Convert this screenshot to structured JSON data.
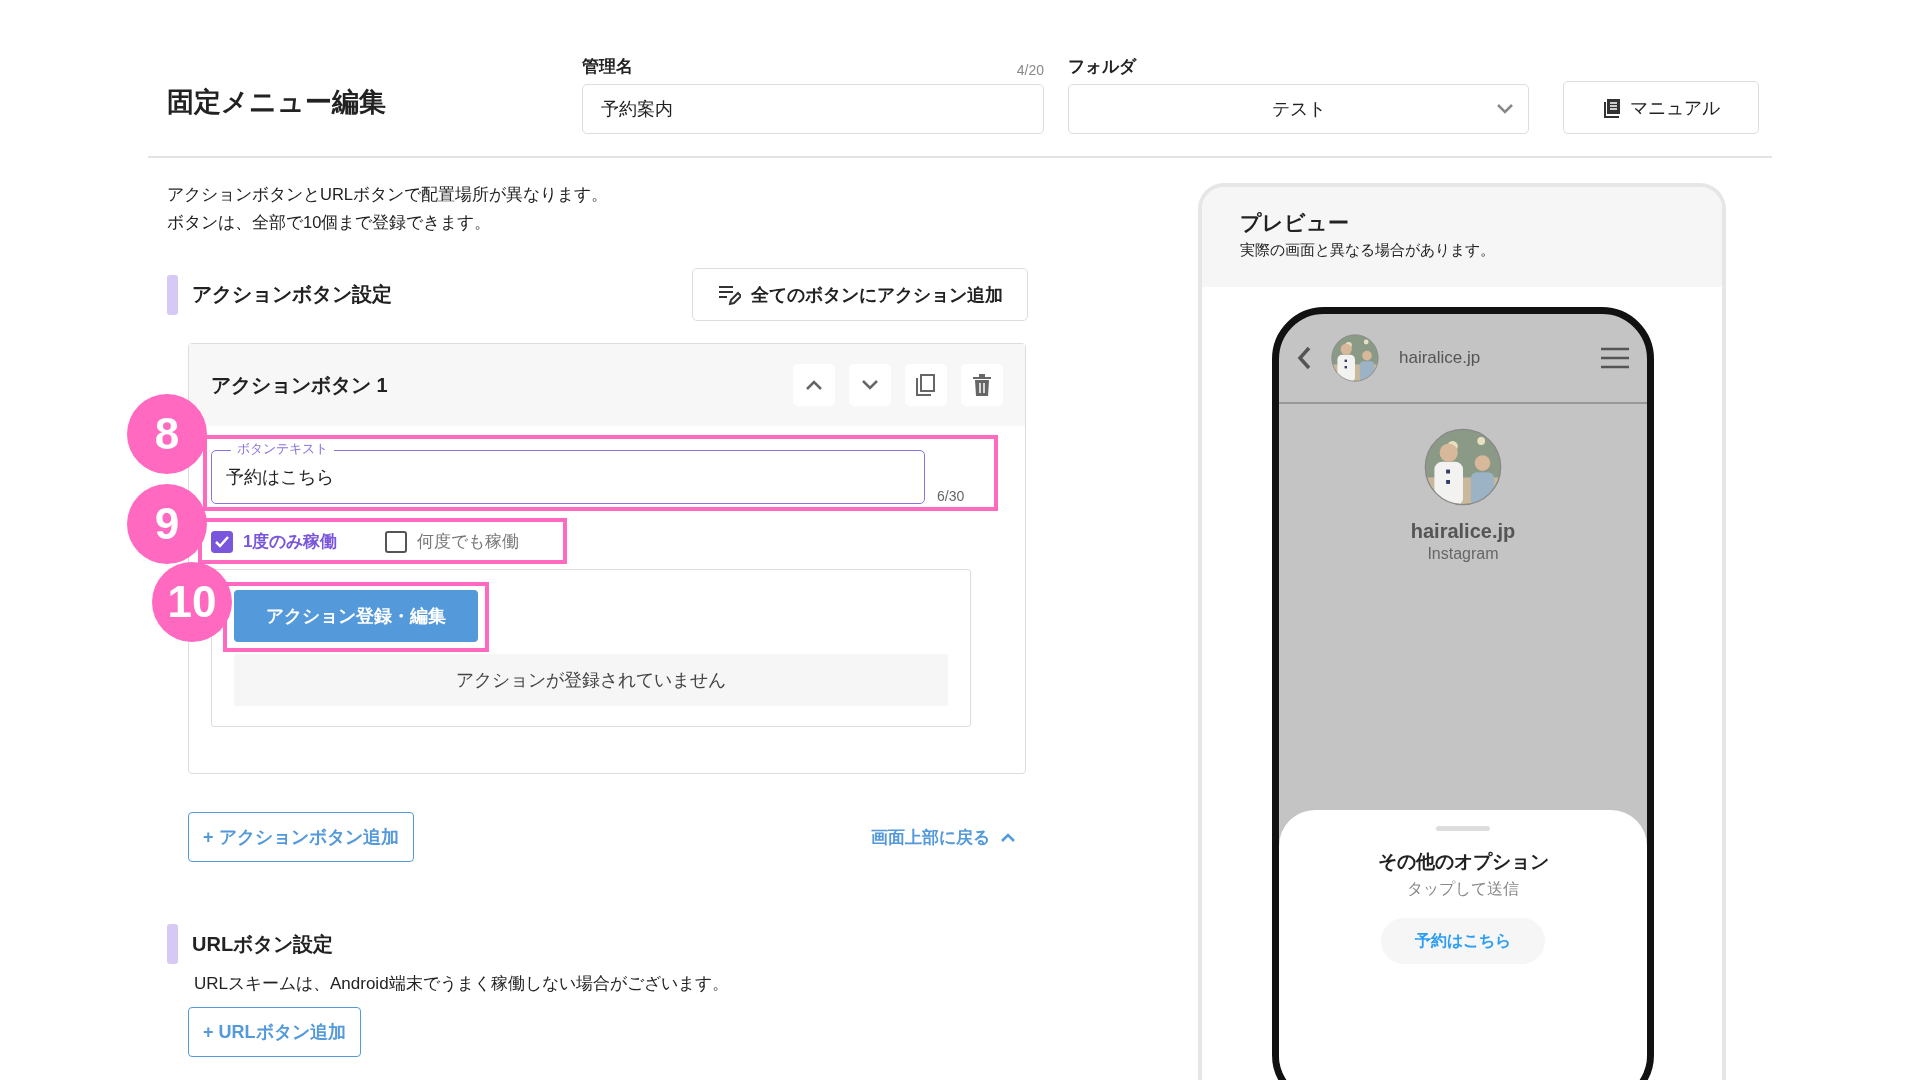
{
  "header": {
    "title": "固定メニュー編集",
    "name_field": {
      "label": "管理名",
      "counter": "4/20",
      "value": "予約案内"
    },
    "folder": {
      "label": "フォルダ",
      "value": "テスト"
    },
    "manual_button": "マニュアル"
  },
  "intro": [
    "アクションボタンとURLボタンで配置場所が異なります。",
    "ボタンは、全部で10個まで登録できます。"
  ],
  "action_section": {
    "title": "アクションボタン設定",
    "add_all_button": "全てのボタンにアクション追加",
    "card": {
      "title": "アクションボタン 1",
      "field": {
        "label": "ボタンテキスト",
        "value": "予約はこちら",
        "counter": "6/30",
        "callout": "8"
      },
      "options": [
        {
          "label": "1度のみ稼働",
          "checked": true
        },
        {
          "label": "何度でも稼働",
          "checked": false
        }
      ],
      "options_callout": "9",
      "action_button": {
        "label": "アクション登録・編集",
        "callout": "10"
      },
      "empty_message": "アクションが登録されていません"
    },
    "add_button": "+ アクションボタン追加",
    "back_to_top": "画面上部に戻る"
  },
  "url_section": {
    "title": "URLボタン設定",
    "note": "URLスキームは、Android端末でうまく稼働しない場合がございます。",
    "add_button": "+ URLボタン追加"
  },
  "preview": {
    "title": "プレビュー",
    "note": "実際の画面と異なる場合があります。",
    "phone": {
      "account": "hairalice.jp",
      "profile_name": "hairalice.jp",
      "profile_service": "Instagram",
      "sheet_title": "その他のオプション",
      "sheet_subtitle": "タップして送信",
      "sheet_button": "予約はこちら"
    }
  }
}
